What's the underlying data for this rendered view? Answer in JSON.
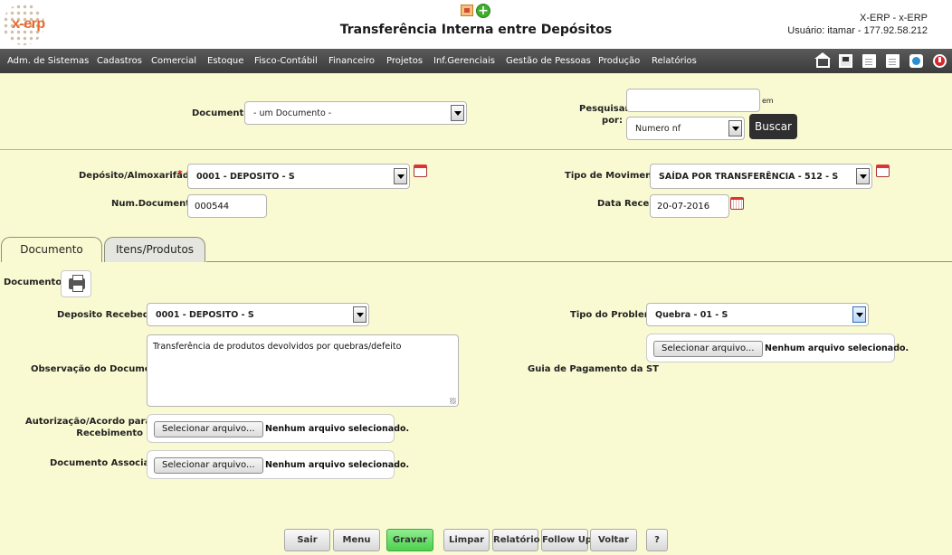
{
  "header": {
    "logo_text": "x-erp",
    "title": "Transferência Interna entre Depósitos",
    "system": "X-ERP - x-ERP",
    "user": "Usuário: itamar - 177.92.58.212"
  },
  "menu": {
    "items": [
      "Adm. de Sistemas",
      "Cadastros",
      "Comercial",
      "Estoque",
      "Fisco-Contábil",
      "Financeiro",
      "Projetos",
      "Inf.Gerenciais",
      "Gestão de Pessoas",
      "Produção",
      "Relatórios"
    ]
  },
  "search": {
    "documento_label": "Documento",
    "documento_value": "- um Documento -",
    "pesquisar_label_1": "Pesquisar",
    "pesquisar_label_2": "por:",
    "em_label": "em",
    "query_value": "",
    "field_value": "Numero nf",
    "buscar_label": "Buscar"
  },
  "form": {
    "deposito_label": "Depósito/Almoxarifado",
    "required_mark": "*",
    "deposito_value": "0001 - DEPOSITO - S",
    "tipo_movimento_label": "Tipo de Movimento",
    "tipo_movimento_value": "SAÍDA POR TRANSFERÊNCIA - 512 - S",
    "num_documento_label": "Num.Documento",
    "num_documento_value": "000544",
    "data_receb_label": "Data Receb.",
    "data_receb_value": "20-07-2016"
  },
  "tabs": [
    {
      "label": "Documento",
      "active": true
    },
    {
      "label": "Itens/Produtos",
      "active": false
    }
  ],
  "documento_tab": {
    "documentos_label": "Documentos",
    "deposito_recebedor_label": "Deposito Recebedor",
    "deposito_recebedor_value": "0001 - DEPOSITO - S",
    "tipo_problema_label": "Tipo do Problema",
    "tipo_problema_value": "Quebra - 01 - S",
    "observacao_label": "Observação do Documento",
    "observacao_value": "Transferência de produtos devolvidos por quebras/defeito",
    "guia_label": "Guia de Pagamento da ST",
    "autorizacao_label_1": "Autorização/Acordo para",
    "autorizacao_label_2": "Recebimento",
    "doc_associado_label": "Documento Associado",
    "file_button_label": "Selecionar arquivo...",
    "file_status": "Nenhum arquivo selecionado."
  },
  "buttons": {
    "sair": "Sair",
    "menu": "Menu",
    "gravar": "Gravar",
    "limpar": "Limpar",
    "relatorio": "Relatório",
    "follow_up": "Follow Up",
    "voltar": "Voltar",
    "help": "?"
  },
  "colors": {
    "background": "#fafad2",
    "menubar": "#3b3b3b",
    "gravar": "#4ed04e",
    "logo": "#e8682c"
  }
}
